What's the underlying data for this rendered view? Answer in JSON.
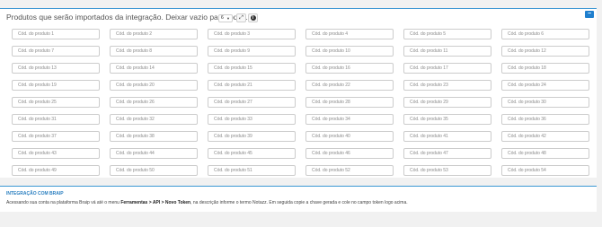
{
  "products_panel": {
    "title": "Produtos que serão importados da integração. Deixar vazio para todos.",
    "filter_select_value": "6",
    "collapse_label": "−",
    "fields": [
      {
        "placeholder": "Cód. do produto 1"
      },
      {
        "placeholder": "Cód. do produto 2"
      },
      {
        "placeholder": "Cód. do produto 3"
      },
      {
        "placeholder": "Cód. do produto 4"
      },
      {
        "placeholder": "Cód. do produto 5"
      },
      {
        "placeholder": "Cód. do produto 6"
      },
      {
        "placeholder": "Cód. do produto 7"
      },
      {
        "placeholder": "Cód. do produto 8"
      },
      {
        "placeholder": "Cód. do produto 9"
      },
      {
        "placeholder": "Cód. do produto 10"
      },
      {
        "placeholder": "Cód. do produto 11"
      },
      {
        "placeholder": "Cód. do produto 12"
      },
      {
        "placeholder": "Cód. do produto 13"
      },
      {
        "placeholder": "Cód. do produto 14"
      },
      {
        "placeholder": "Cód. do produto 15"
      },
      {
        "placeholder": "Cód. do produto 16"
      },
      {
        "placeholder": "Cód. do produto 17"
      },
      {
        "placeholder": "Cód. do produto 18"
      },
      {
        "placeholder": "Cód. do produto 19"
      },
      {
        "placeholder": "Cód. do produto 20"
      },
      {
        "placeholder": "Cód. do produto 21"
      },
      {
        "placeholder": "Cód. do produto 22"
      },
      {
        "placeholder": "Cód. do produto 23"
      },
      {
        "placeholder": "Cód. do produto 24"
      },
      {
        "placeholder": "Cód. do produto 25"
      },
      {
        "placeholder": "Cód. do produto 26"
      },
      {
        "placeholder": "Cód. do produto 27"
      },
      {
        "placeholder": "Cód. do produto 28"
      },
      {
        "placeholder": "Cód. do produto 29"
      },
      {
        "placeholder": "Cód. do produto 30"
      },
      {
        "placeholder": "Cód. do produto 31"
      },
      {
        "placeholder": "Cód. do produto 32"
      },
      {
        "placeholder": "Cód. do produto 33"
      },
      {
        "placeholder": "Cód. do produto 34"
      },
      {
        "placeholder": "Cód. do produto 35"
      },
      {
        "placeholder": "Cód. do produto 36"
      },
      {
        "placeholder": "Cód. do produto 37"
      },
      {
        "placeholder": "Cód. do produto 38"
      },
      {
        "placeholder": "Cód. do produto 39"
      },
      {
        "placeholder": "Cód. do produto 40"
      },
      {
        "placeholder": "Cód. do produto 41"
      },
      {
        "placeholder": "Cód. do produto 42"
      },
      {
        "placeholder": "Cód. do produto 43"
      },
      {
        "placeholder": "Cód. do produto 44"
      },
      {
        "placeholder": "Cód. do produto 45"
      },
      {
        "placeholder": "Cód. do produto 46"
      },
      {
        "placeholder": "Cód. do produto 47"
      },
      {
        "placeholder": "Cód. do produto 48"
      },
      {
        "placeholder": "Cód. do produto 49"
      },
      {
        "placeholder": "Cód. do produto 50"
      },
      {
        "placeholder": "Cód. do produto 51"
      },
      {
        "placeholder": "Cód. do produto 52"
      },
      {
        "placeholder": "Cód. do produto 53"
      },
      {
        "placeholder": "Cód. do produto 54"
      }
    ]
  },
  "integration_panel": {
    "title": "INTEGRAÇÃO COM BRAIP",
    "text_before": "Acessando sua conta na plataforma Braip vá até o menu ",
    "text_bold": "Ferramentas > API > Novo Token",
    "text_after": ", na descrição informe o termo Notazz. Em seguida copie a chave gerada e cole no campo token logo acima."
  },
  "icons": {
    "expand": "expand-arrows-icon",
    "info": "info-circle-icon",
    "collapse": "minus-icon",
    "caret": "chevron-down-icon"
  },
  "colors": {
    "accent": "#3c97d3",
    "button_blue": "#1f7fce",
    "integration_title": "#2a7fc0"
  }
}
